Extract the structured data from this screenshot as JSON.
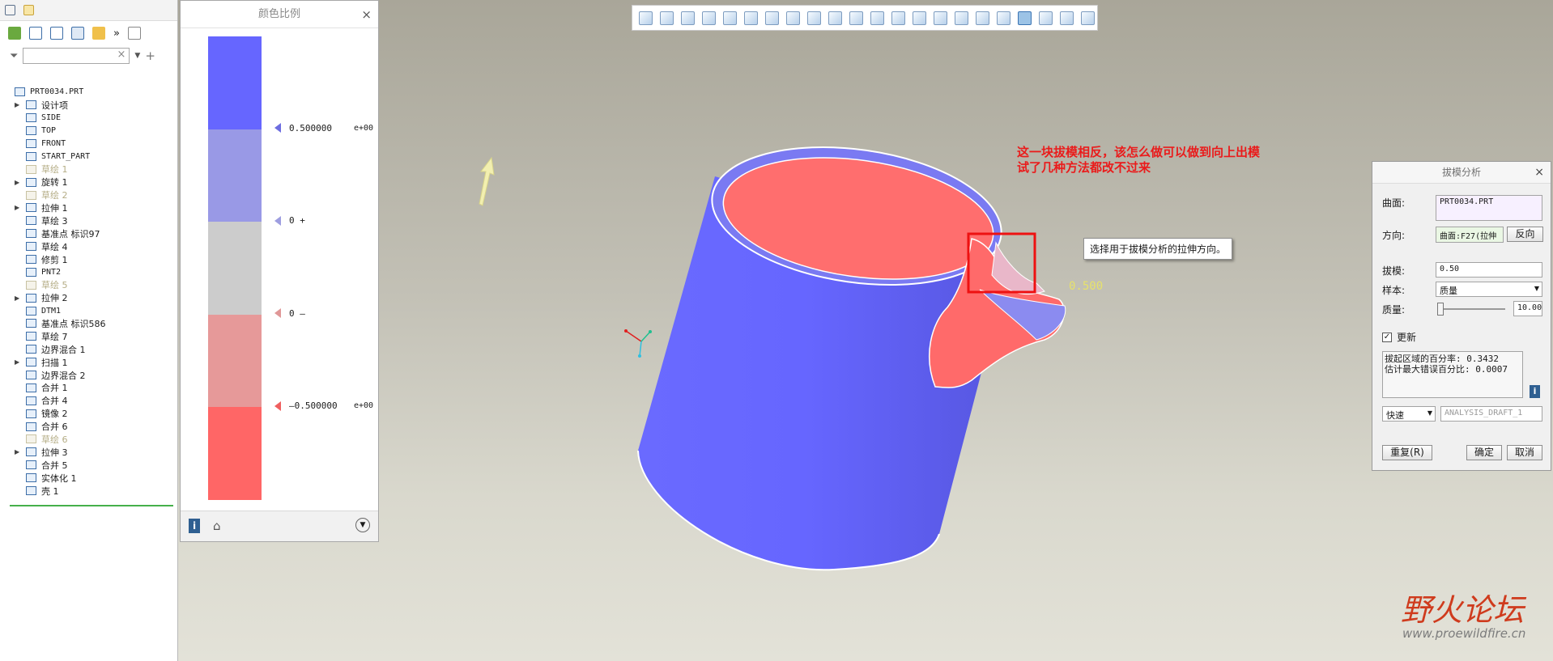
{
  "model_tree": {
    "filter_placeholder": "",
    "items": [
      {
        "label": "PRT0034.PRT",
        "icon": "part-icon",
        "expandable": false,
        "dim": false,
        "root": true
      },
      {
        "label": "设计项",
        "icon": "design-items-icon",
        "expandable": true,
        "dim": false
      },
      {
        "label": "SIDE",
        "icon": "datum-plane-icon",
        "expandable": false,
        "dim": false
      },
      {
        "label": "TOP",
        "icon": "datum-plane-icon",
        "expandable": false,
        "dim": false
      },
      {
        "label": "FRONT",
        "icon": "datum-plane-icon",
        "expandable": false,
        "dim": false
      },
      {
        "label": "START_PART",
        "icon": "coordinate-system-icon",
        "expandable": false,
        "dim": false
      },
      {
        "label": "草绘 1",
        "icon": "sketch-icon",
        "expandable": false,
        "dim": true
      },
      {
        "label": "旋转 1",
        "icon": "revolve-icon",
        "expandable": true,
        "dim": false
      },
      {
        "label": "草绘 2",
        "icon": "sketch-icon",
        "expandable": false,
        "dim": true
      },
      {
        "label": "拉伸 1",
        "icon": "extrude-icon",
        "expandable": true,
        "dim": false
      },
      {
        "label": "草绘 3",
        "icon": "sketch-icon",
        "expandable": false,
        "dim": false
      },
      {
        "label": "基准点 标识97",
        "icon": "datum-point-icon",
        "expandable": false,
        "dim": false
      },
      {
        "label": "草绘 4",
        "icon": "sketch-icon",
        "expandable": false,
        "dim": false
      },
      {
        "label": "修剪 1",
        "icon": "trim-icon",
        "expandable": false,
        "dim": false
      },
      {
        "label": "PNT2",
        "icon": "datum-point-icon",
        "expandable": false,
        "dim": false
      },
      {
        "label": "草绘 5",
        "icon": "sketch-icon",
        "expandable": false,
        "dim": true
      },
      {
        "label": "拉伸 2",
        "icon": "extrude-icon",
        "expandable": true,
        "dim": false
      },
      {
        "label": "DTM1",
        "icon": "datum-plane-icon",
        "expandable": false,
        "dim": false
      },
      {
        "label": "基准点 标识586",
        "icon": "datum-point-icon",
        "expandable": false,
        "dim": false
      },
      {
        "label": "草绘 7",
        "icon": "sketch-icon",
        "expandable": false,
        "dim": false
      },
      {
        "label": "边界混合 1",
        "icon": "boundary-blend-icon",
        "expandable": false,
        "dim": false
      },
      {
        "label": "扫描 1",
        "icon": "sweep-icon",
        "expandable": true,
        "dim": false
      },
      {
        "label": "边界混合 2",
        "icon": "boundary-blend-icon",
        "expandable": false,
        "dim": false
      },
      {
        "label": "合并 1",
        "icon": "merge-icon",
        "expandable": false,
        "dim": false
      },
      {
        "label": "合并 4",
        "icon": "merge-icon",
        "expandable": false,
        "dim": false
      },
      {
        "label": "镜像 2",
        "icon": "mirror-icon",
        "expandable": false,
        "dim": false
      },
      {
        "label": "合并 6",
        "icon": "merge-icon",
        "expandable": false,
        "dim": false
      },
      {
        "label": "草绘 6",
        "icon": "sketch-icon",
        "expandable": false,
        "dim": true
      },
      {
        "label": "拉伸 3",
        "icon": "extrude-icon",
        "expandable": true,
        "dim": false
      },
      {
        "label": "合并 5",
        "icon": "merge-icon",
        "expandable": false,
        "dim": false
      },
      {
        "label": "实体化 1",
        "icon": "solidify-icon",
        "expandable": false,
        "dim": false
      },
      {
        "label": "壳 1",
        "icon": "shell-icon",
        "expandable": false,
        "dim": false
      }
    ]
  },
  "color_scale": {
    "title": "颜色比例",
    "colors": [
      "#6666ff",
      "#9999e6",
      "#cccccc",
      "#e69999",
      "#ff6666"
    ],
    "markers": [
      {
        "value": "0.500000",
        "exp": "e+00",
        "color": "#6d6de0"
      },
      {
        "value": "0 +",
        "exp": "",
        "color": "#9e9ee0"
      },
      {
        "value": "0 –",
        "exp": "",
        "color": "#e09898"
      },
      {
        "value": "–0.500000",
        "exp": "e+00",
        "color": "#ef5f5f"
      }
    ]
  },
  "annotation": {
    "text": "这一块拔模相反，该怎么做可以做到向上出模\n试了几种方法都改不过来",
    "color": "#ea1b1b"
  },
  "tooltip": {
    "text": "选择用于拔模分析的拉伸方向。"
  },
  "draft_label": "0.500",
  "dialog": {
    "title": "拔模分析",
    "surface_label": "曲面:",
    "surface_value": "PRT0034.PRT",
    "direction_label": "方向:",
    "direction_value": "曲面:F27(拉伸",
    "reverse_button": "反向",
    "draft_label": "拔模:",
    "draft_value": "0.50",
    "sample_label": "样本:",
    "sample_value": "质量",
    "quality_label": "质量:",
    "quality_value": "10.00",
    "quality_level": 0.05,
    "update_label": "更新",
    "update_checked": true,
    "info_line1": "拔起区域的百分率: 0.3432",
    "info_line2": "估计最大错误百分比: 0.0007",
    "mode_value": "快速",
    "analysis_name": "ANALYSIS_DRAFT_1",
    "repeat_button": "重复(R)",
    "ok_button": "确定",
    "cancel_button": "取消"
  },
  "watermark": {
    "main": "野火论坛",
    "url": "www.proewildfire.cn"
  },
  "colors": {
    "positive": "#6666ff",
    "negative": "#ff6666",
    "highlight_box": "#ee1111"
  }
}
